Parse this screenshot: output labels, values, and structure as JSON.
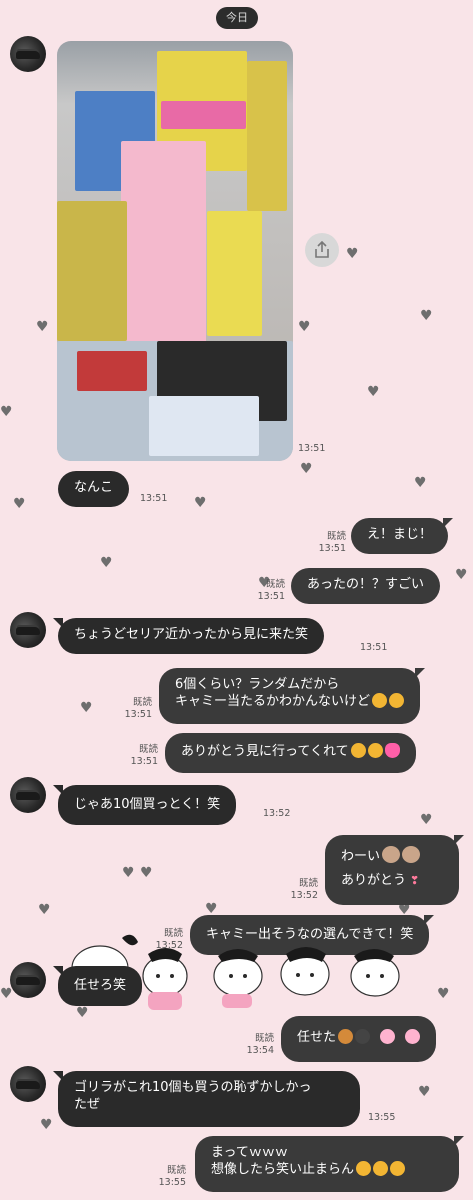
{
  "date_label": "今日",
  "messages": {
    "m_photo": {
      "time": "13:51"
    },
    "m1": {
      "text": "なんこ",
      "time": "13:51"
    },
    "m2": {
      "text": "え！まじ！",
      "read": "既読",
      "time": "13:51"
    },
    "m3": {
      "text": "あったの！？すごい",
      "read": "既読",
      "time": "13:51"
    },
    "m4": {
      "text": "ちょうどセリア近かったから見に来た笑",
      "time": "13:51"
    },
    "m5": {
      "line1": "6個くらい？ランダムだから",
      "line2": "キャミー当たるかわかんないけど",
      "read": "既読",
      "time": "13:51"
    },
    "m6": {
      "text": "ありがとう見に行ってくれて",
      "read": "既読",
      "time": "13:51"
    },
    "m7": {
      "text": "じゃあ10個買っとく！笑",
      "time": "13:52"
    },
    "m8": {
      "line1": "わーい",
      "line2": "ありがとう",
      "read": "既読",
      "time": "13:52"
    },
    "m9": {
      "text": "キャミー出そうなの選んできて！笑",
      "read": "既読",
      "time": "13:52"
    },
    "m10": {
      "text": "任せろ笑"
    },
    "m11": {
      "text": "任せた",
      "read": "既読",
      "time": "13:54"
    },
    "m12": {
      "line1": "ゴリラがこれ10個も買うの恥ずかしかっ",
      "line2": "たぜ",
      "time": "13:55"
    },
    "m13": {
      "line1": "まってｗｗｗ",
      "line2": "想像したら笑い止まらん",
      "read": "既読",
      "time": "13:55"
    }
  },
  "colors": {
    "background": "#f9e4e8",
    "bubble_received": "#2a2a2a",
    "bubble_sent": "#3a3a3a",
    "heart": "#6e6e6e"
  },
  "icons": [
    "heart-icon",
    "share-icon",
    "avatar-image",
    "laughing-emoji",
    "crying-emoji",
    "pink-heart-emoji",
    "bear-emoji",
    "muscle-emoji",
    "gorilla-emoji"
  ]
}
